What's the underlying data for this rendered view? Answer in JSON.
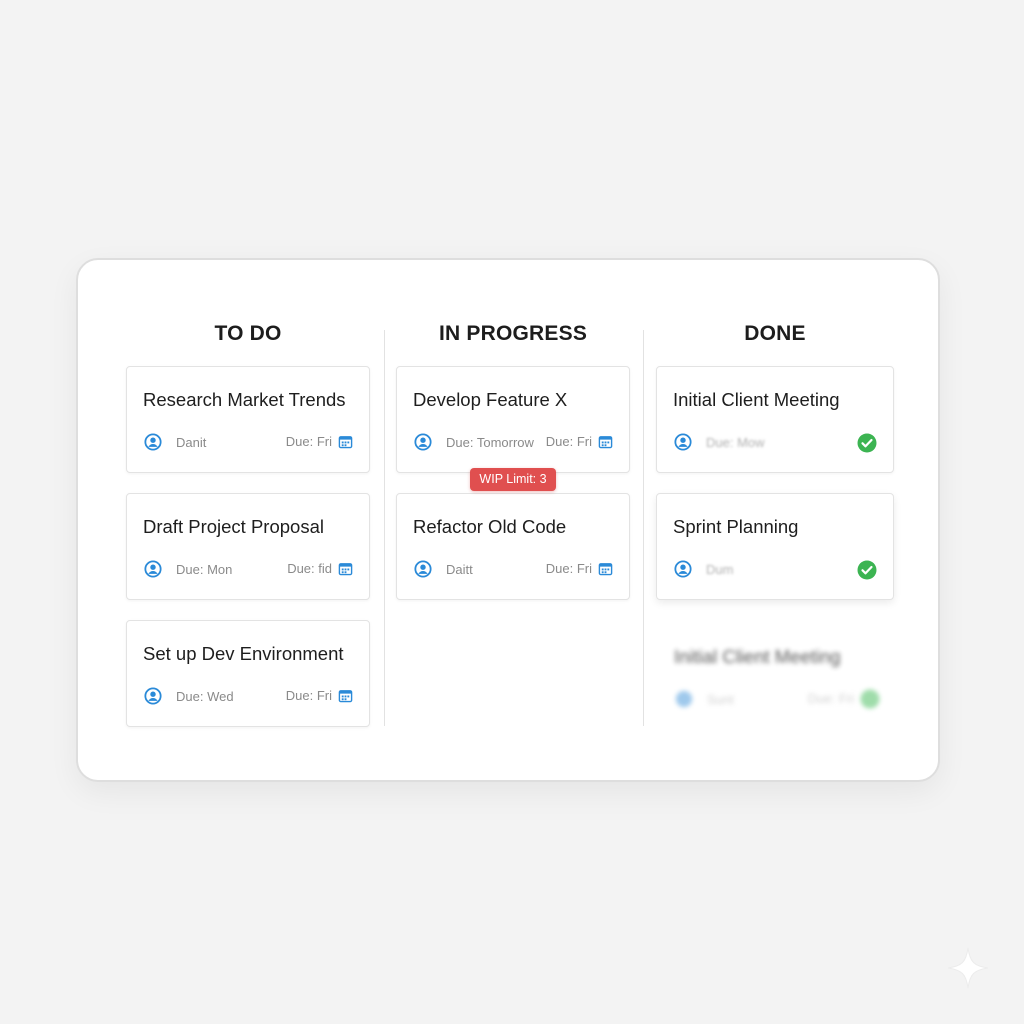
{
  "columns": [
    {
      "title": "TO DO",
      "cards": [
        {
          "title": "Research Market Trends",
          "assignee": "Danit",
          "due": "Due: Fri"
        },
        {
          "title": "Draft Project Proposal",
          "assignee": "Due: Mon",
          "due": "Due: fid"
        },
        {
          "title": "Set up Dev Environment",
          "assignee": "Due: Wed",
          "due": "Due: Fri"
        }
      ]
    },
    {
      "title": "IN PROGRESS",
      "wip_badge": "WIP Limit: 3",
      "cards": [
        {
          "title": "Develop Feature X",
          "assignee": "Due: Tomorrow",
          "due": "Due: Fri"
        },
        {
          "title": "Refactor Old Code",
          "assignee": "Daitt",
          "due": "Due: Fri"
        }
      ]
    },
    {
      "title": "DONE",
      "cards": [
        {
          "title": "Initial Client Meeting",
          "assignee": "Due: Mow"
        },
        {
          "title": "Sprint Planning",
          "assignee": "Dum"
        }
      ],
      "ghost_card": {
        "title": "Initial Client Meeting",
        "assignee": "Sunt",
        "due": "Due: Fri"
      }
    }
  ],
  "icons": {
    "assignee": "user-circle-icon",
    "due": "calendar-icon",
    "done": "check-circle-icon"
  },
  "colors": {
    "accent": "#2a8ad8",
    "done": "#3cb452",
    "wip": "#e04f4f"
  }
}
